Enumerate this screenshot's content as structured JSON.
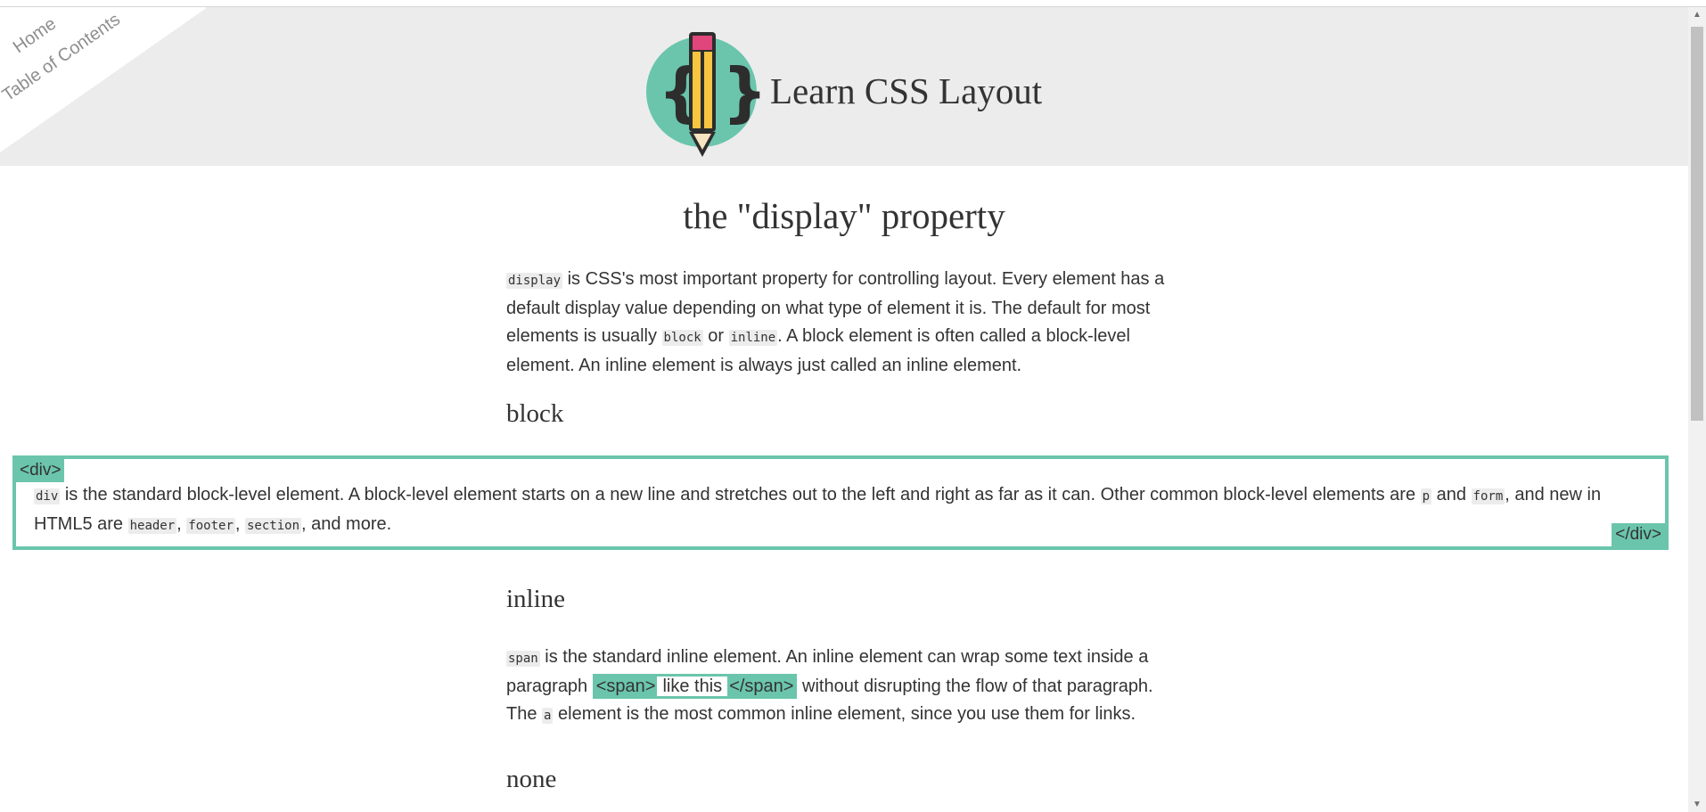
{
  "nav": {
    "home": "Home",
    "toc": "Table of Contents"
  },
  "header": {
    "site_title": "Learn CSS Layout",
    "logo_icon": "pencil-braces-logo"
  },
  "page": {
    "title": "the \"display\" property",
    "intro": {
      "code_display": "display",
      "t1": " is CSS's most important property for controlling layout. Every element has a default display value depending on what type of element it is. The default for most elements is usually ",
      "code_block": "block",
      "t2": " or ",
      "code_inline": "inline",
      "t3": ". A block element is often called a block-level element. An inline element is always just called an inline element."
    },
    "block_heading": "block",
    "block_demo": {
      "open_tag": "<div>",
      "close_tag": "</div>",
      "code_div": "div",
      "t1": " is the standard block-level element. A block-level element starts on a new line and stretches out to the left and right as far as it can. Other common block-level elements are ",
      "code_p": "p",
      "t2": " and ",
      "code_form": "form",
      "t3": ", and new in HTML5 are ",
      "code_header": "header",
      "t4": ", ",
      "code_footer": "footer",
      "t5": ", ",
      "code_section": "section",
      "t6": ", and more."
    },
    "inline_heading": "inline",
    "inline_para": {
      "code_span": "span",
      "t1": " is the standard inline element. An inline element can wrap some text inside a paragraph ",
      "span_open": "<span>",
      "span_inner": "like this",
      "span_close": "</span>",
      "t2": " without disrupting the flow of that paragraph. The ",
      "code_a": "a",
      "t3": " element is the most common inline element, since you use them for links."
    },
    "none_heading": "none"
  },
  "colors": {
    "accent": "#6ac5ac",
    "header_bg": "#ececec",
    "text": "#333333"
  }
}
